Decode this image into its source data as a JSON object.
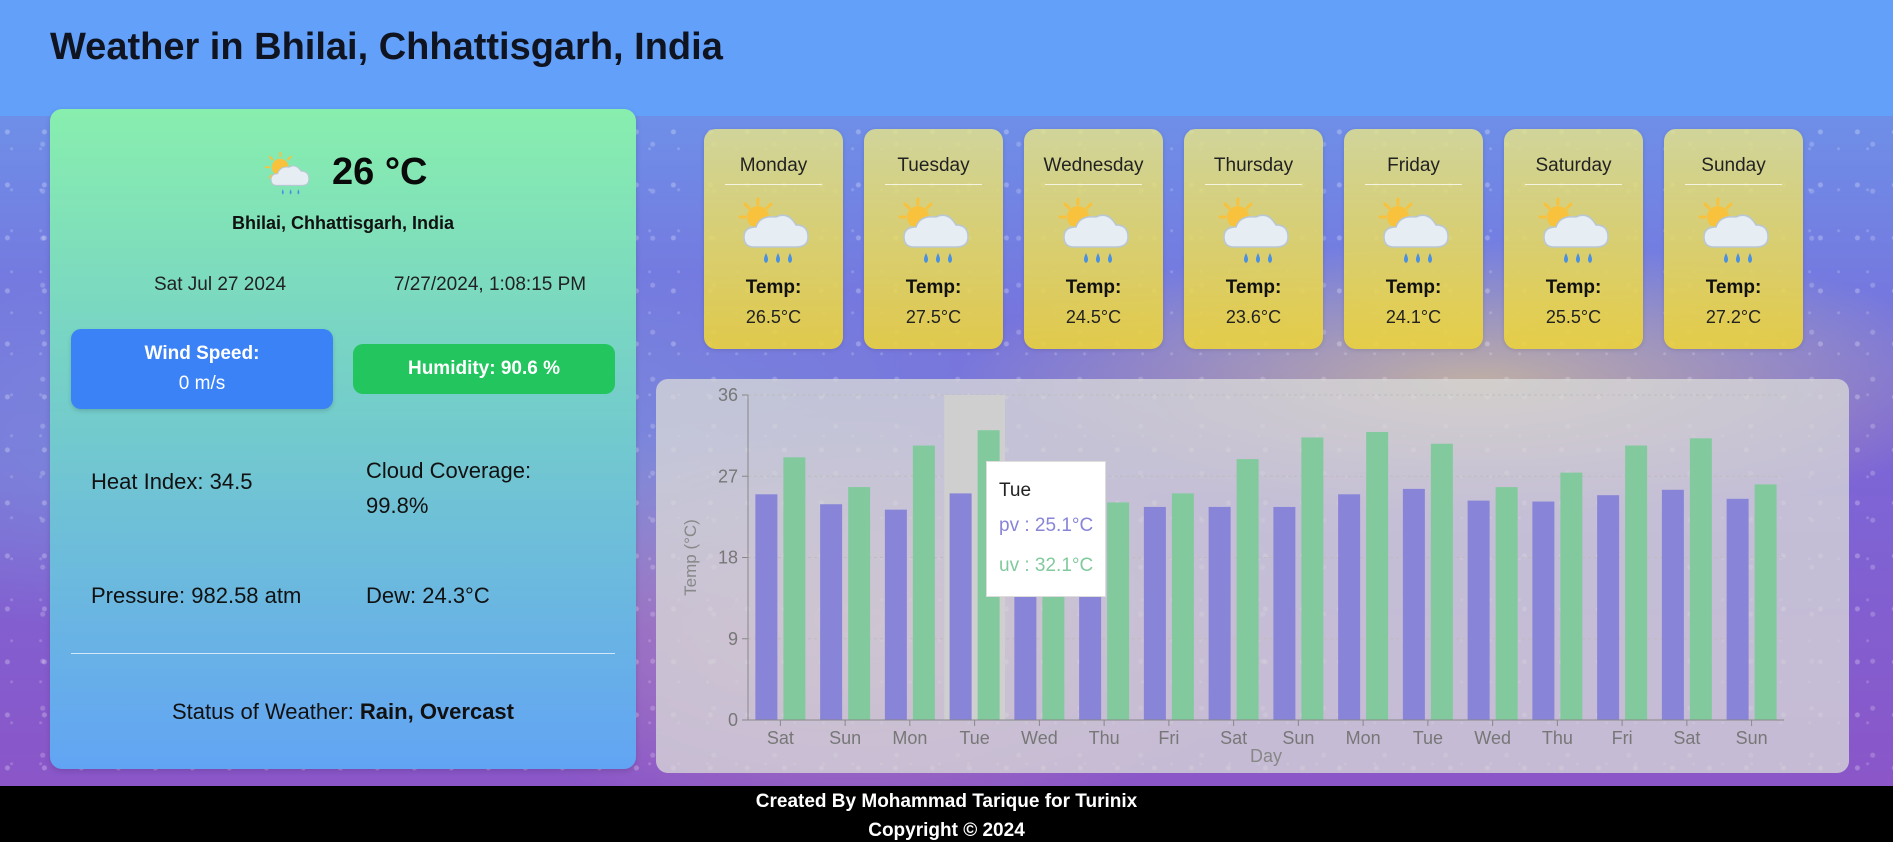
{
  "header": {
    "title": "Weather in Bhilai, Chhattisgarh, India"
  },
  "current": {
    "icon": "partly-sunny-rain-icon",
    "temperature": "26 °C",
    "location": "Bhilai, Chhattisgarh, India",
    "date": "Sat Jul 27 2024",
    "datetime": "7/27/2024, 1:08:15 PM",
    "wind_label": "Wind Speed:",
    "wind_value": "0 m/s",
    "humidity": "Humidity: 90.6 %",
    "heat_index": "Heat Index: 34.5",
    "cloud_coverage": "Cloud Coverage: 99.8%",
    "pressure": "Pressure: 982.58 atm",
    "dew": "Dew: 24.3°C",
    "status_label": "Status of Weather: ",
    "status_value": "Rain, Overcast"
  },
  "forecast": {
    "temp_label": "Temp:",
    "days": [
      {
        "day": "Monday",
        "temp": "26.5°C",
        "icon": "partly-sunny-rain-icon"
      },
      {
        "day": "Tuesday",
        "temp": "27.5°C",
        "icon": "partly-sunny-rain-icon"
      },
      {
        "day": "Wednesday",
        "temp": "24.5°C",
        "icon": "partly-sunny-rain-icon"
      },
      {
        "day": "Thursday",
        "temp": "23.6°C",
        "icon": "partly-sunny-rain-icon"
      },
      {
        "day": "Friday",
        "temp": "24.1°C",
        "icon": "partly-sunny-rain-icon"
      },
      {
        "day": "Saturday",
        "temp": "25.5°C",
        "icon": "partly-sunny-rain-icon"
      },
      {
        "day": "Sunday",
        "temp": "27.2°C",
        "icon": "partly-sunny-rain-icon"
      }
    ]
  },
  "tooltip": {
    "day": "Tue",
    "pv": "pv : 25.1°C",
    "uv": "uv : 32.1°C"
  },
  "chart_data": {
    "type": "bar",
    "xlabel": "Day",
    "ylabel": "Temp (°C)",
    "ylim": [
      0,
      36
    ],
    "yticks": [
      0,
      9,
      18,
      27,
      36
    ],
    "categories": [
      "Sat",
      "Sun",
      "Mon",
      "Tue",
      "Wed",
      "Thu",
      "Fri",
      "Sat",
      "Sun",
      "Mon",
      "Tue",
      "Wed",
      "Thu",
      "Fri",
      "Sat",
      "Sun"
    ],
    "highlight_index": 3,
    "grid": true,
    "series": [
      {
        "name": "pv",
        "color": "#8884d8",
        "values": [
          25.0,
          23.9,
          23.3,
          25.1,
          24.6,
          24.0,
          23.6,
          23.6,
          23.6,
          25.0,
          25.6,
          24.3,
          24.2,
          24.9,
          25.5,
          24.5
        ]
      },
      {
        "name": "uv",
        "color": "#82ca9d",
        "values": [
          29.1,
          25.8,
          30.4,
          32.1,
          25.0,
          24.1,
          25.1,
          28.9,
          31.3,
          31.9,
          30.6,
          25.8,
          27.4,
          30.4,
          31.2,
          26.1
        ]
      }
    ]
  },
  "footer": {
    "credit": "Created By Mohammad Tarique for Turinix",
    "copyright": "Copyright © 2024"
  }
}
